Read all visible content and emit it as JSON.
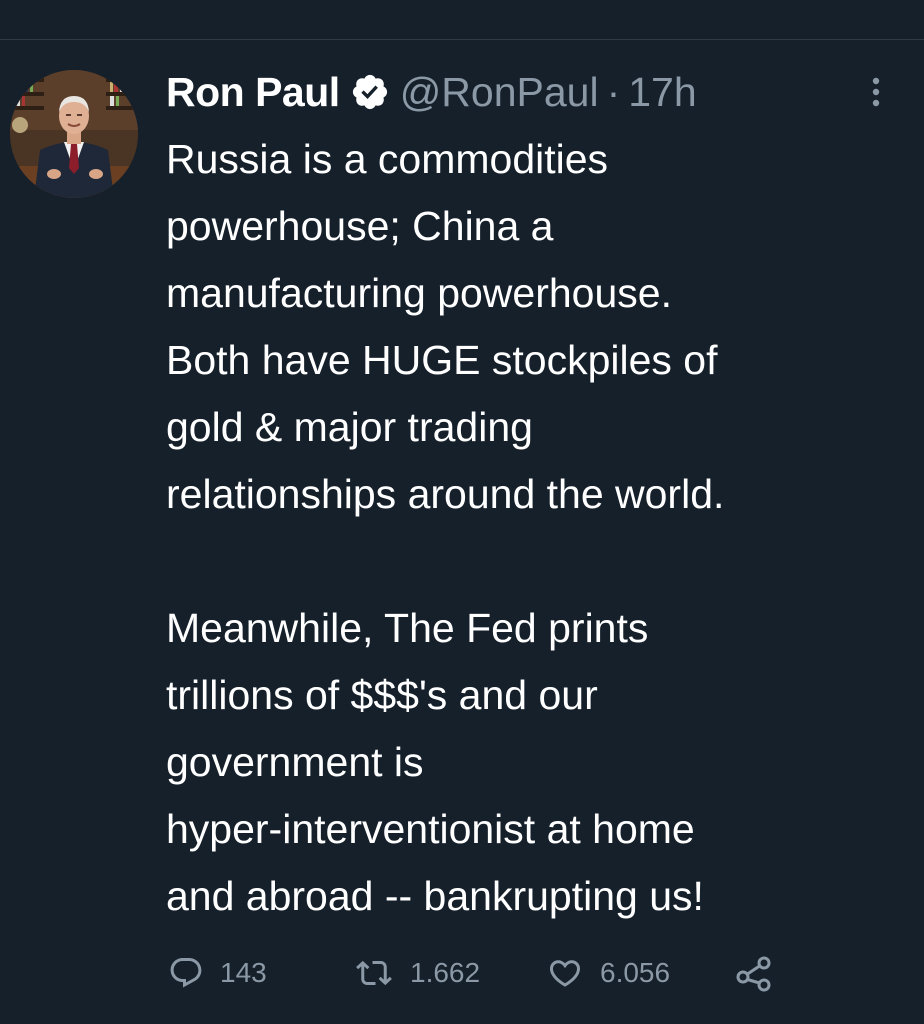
{
  "tweet": {
    "author": {
      "name": "Ron Paul",
      "handle": "@RonPaul",
      "verified": true
    },
    "separator": "·",
    "time": "17h",
    "text": {
      "paragraph_1": [
        "Russia is a commodities",
        "powerhouse; China a",
        "manufacturing powerhouse.",
        "Both have HUGE stockpiles of",
        "gold & major trading",
        "relationships around the world."
      ],
      "paragraph_2": [
        "Meanwhile, The Fed prints",
        "trillions of $$$'s and our",
        "government is",
        "hyper-interventionist at home",
        "and abroad -- bankrupting us!"
      ]
    },
    "actions": {
      "replies": "143",
      "retweets": "1.662",
      "likes": "6.056"
    }
  },
  "icons": {
    "verified": "verified-badge-icon",
    "more": "more-options-icon",
    "reply": "reply-icon",
    "retweet": "retweet-icon",
    "like": "heart-icon",
    "share": "share-icon"
  },
  "colors": {
    "background": "#15202b",
    "text": "#ffffff",
    "muted": "#8b98a5",
    "divider": "#2f3a46"
  }
}
